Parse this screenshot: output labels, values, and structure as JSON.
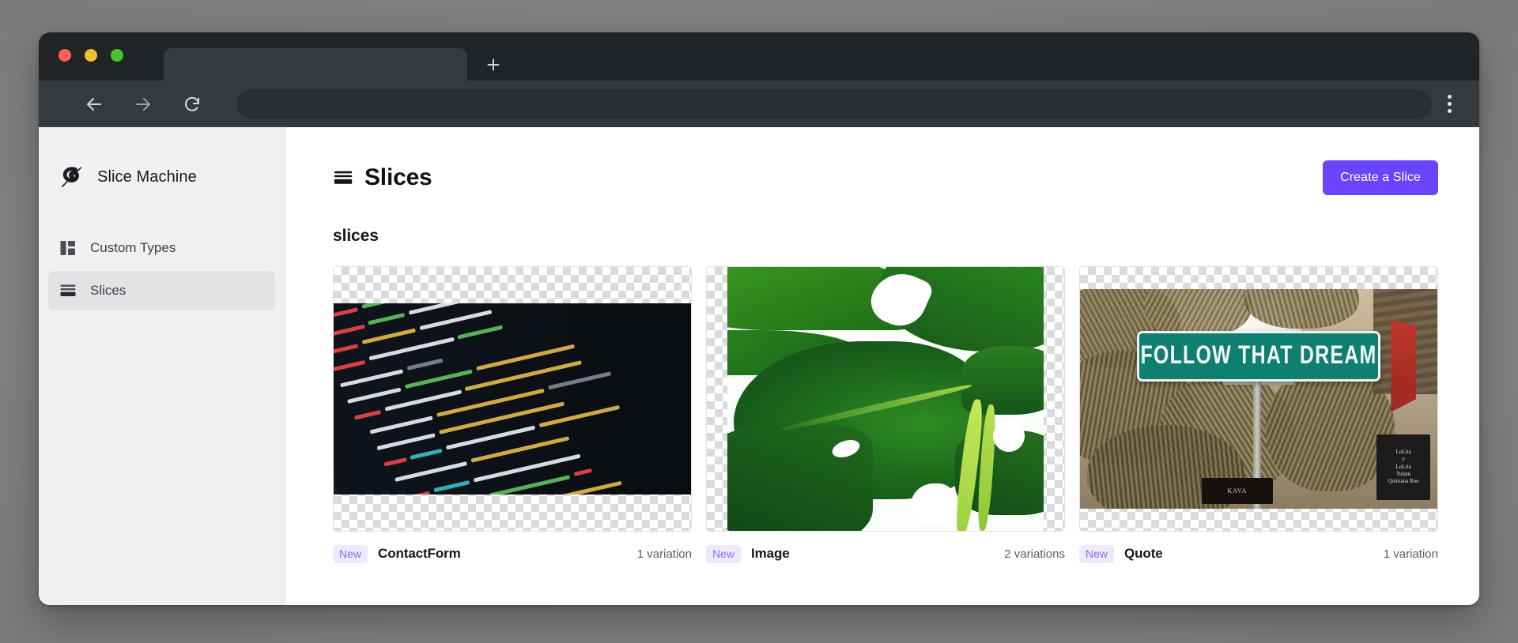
{
  "browser": {
    "traffic_lights": [
      "close",
      "minimize",
      "maximize"
    ],
    "tab_title": "",
    "new_tab_label": "+",
    "address_value": "",
    "address_placeholder": "",
    "back_icon": "arrow-left-icon",
    "forward_icon": "arrow-right-icon",
    "reload_icon": "reload-icon",
    "menu_icon": "kebab-menu-icon"
  },
  "sidebar": {
    "brand": {
      "name": "Slice Machine",
      "logo_icon": "slice-machine-logo"
    },
    "items": [
      {
        "label": "Custom Types",
        "icon": "layout-blocks-icon",
        "active": false
      },
      {
        "label": "Slices",
        "icon": "stacked-layers-icon",
        "active": true
      }
    ]
  },
  "main": {
    "title": "Slices",
    "title_icon": "stacked-layers-icon",
    "create_button": "Create a Slice",
    "section_label": "slices",
    "accent_color": "#6b44ff",
    "badge_color": "#8b6ef0",
    "badge_bg": "#efe9fe",
    "cards": [
      {
        "badge": "New",
        "name": "ContactForm",
        "variations": "1 variation",
        "thumb": "code-screenshot"
      },
      {
        "badge": "New",
        "name": "Image",
        "variations": "2 variations",
        "thumb": "monstera-leaf-photo"
      },
      {
        "badge": "New",
        "name": "Quote",
        "variations": "1 variation",
        "thumb": "street-sign-photo",
        "sign_text": "FOLLOW THAT DREAM",
        "shop_sign_lines": [
          "LoLita",
          "y",
          "LoLita",
          "Tulum",
          "Quintana Roo"
        ],
        "kava_sign_text": "KAVA"
      }
    ]
  }
}
